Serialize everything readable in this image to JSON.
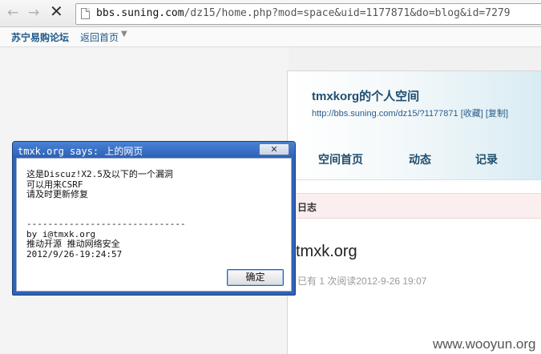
{
  "browser": {
    "url_host": "bbs.suning.com",
    "url_path": "/dz15/home.php?mod=space&uid=1177871&do=blog&id=7279",
    "back_icon": "←",
    "forward_icon": "→",
    "stop_icon": "✕"
  },
  "forum": {
    "name": "苏宁易购论坛",
    "home_link": "返回首页",
    "home_caret": "▼"
  },
  "space": {
    "title": "tmxkorg的个人空间",
    "url": "http://bbs.suning.com/dz15/?1177871",
    "bookmark_link": "[收藏]",
    "copy_link": "[复制]",
    "nav": [
      "空间首页",
      "动态",
      "记录"
    ]
  },
  "blog": {
    "section": "日志",
    "post_title": "tmxk.org",
    "post_meta": "已有 1 次阅读2012-9-26 19:07"
  },
  "dialog": {
    "title": "tmxk.org says: 上的网页",
    "close_label": "✕",
    "message_lines": [
      "这是Discuz!X2.5及以下的一个漏洞",
      "可以用来CSRF",
      "请及时更新修复",
      "",
      "------------------------------",
      "by i@tmxk.org",
      "推动开源 推动网络安全",
      "2012/9/26-19:24:57"
    ],
    "ok_label": "确定"
  },
  "watermark": "www.wooyun.org"
}
